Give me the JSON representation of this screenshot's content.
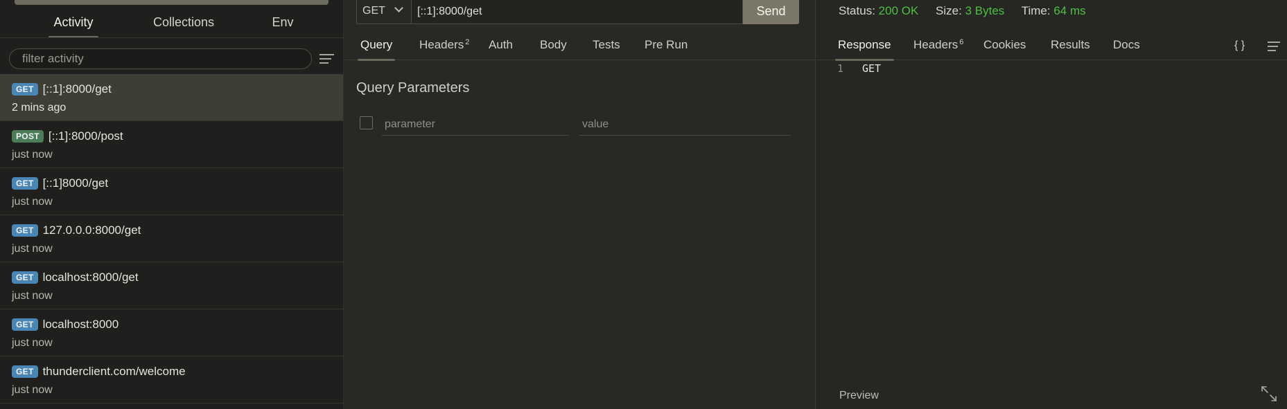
{
  "sidebar": {
    "tabs": [
      {
        "label": "Activity",
        "active": true
      },
      {
        "label": "Collections",
        "active": false
      },
      {
        "label": "Env",
        "active": false
      }
    ],
    "filter_placeholder": "filter activity",
    "activities": [
      {
        "method": "GET",
        "url": "[::1]:8000/get",
        "time": "2 mins ago",
        "selected": true
      },
      {
        "method": "POST",
        "url": "[::1]:8000/post",
        "time": "just now",
        "selected": false
      },
      {
        "method": "GET",
        "url": "[::1]8000/get",
        "time": "just now",
        "selected": false
      },
      {
        "method": "GET",
        "url": "127.0.0.0:8000/get",
        "time": "just now",
        "selected": false
      },
      {
        "method": "GET",
        "url": "localhost:8000/get",
        "time": "just now",
        "selected": false
      },
      {
        "method": "GET",
        "url": "localhost:8000",
        "time": "just now",
        "selected": false
      },
      {
        "method": "GET",
        "url": "thunderclient.com/welcome",
        "time": "just now",
        "selected": false
      }
    ]
  },
  "request": {
    "method": "GET",
    "url": "[::1]:8000/get",
    "send_label": "Send",
    "tabs": [
      {
        "label": "Query",
        "count": "",
        "active": true
      },
      {
        "label": "Headers",
        "count": "2",
        "active": false
      },
      {
        "label": "Auth",
        "count": "",
        "active": false
      },
      {
        "label": "Body",
        "count": "",
        "active": false
      },
      {
        "label": "Tests",
        "count": "",
        "active": false
      },
      {
        "label": "Pre Run",
        "count": "",
        "active": false
      }
    ],
    "query_title": "Query Parameters",
    "param_placeholder": "parameter",
    "value_placeholder": "value"
  },
  "response": {
    "status_label": "Status:",
    "status_value": "200 OK",
    "size_label": "Size:",
    "size_value": "3 Bytes",
    "time_label": "Time:",
    "time_value": "64 ms",
    "tabs": [
      {
        "label": "Response",
        "count": "",
        "active": true
      },
      {
        "label": "Headers",
        "count": "6",
        "active": false
      },
      {
        "label": "Cookies",
        "count": "",
        "active": false
      },
      {
        "label": "Results",
        "count": "",
        "active": false
      },
      {
        "label": "Docs",
        "count": "",
        "active": false
      }
    ],
    "format_icon": "{ }",
    "lines": [
      {
        "number": "1",
        "text": "GET"
      }
    ],
    "preview_label": "Preview"
  },
  "colors": {
    "status_ok": "#4fbf44",
    "get_badge": "#4a86b4",
    "post_badge": "#4c7d58",
    "send_button": "#7b7867"
  }
}
